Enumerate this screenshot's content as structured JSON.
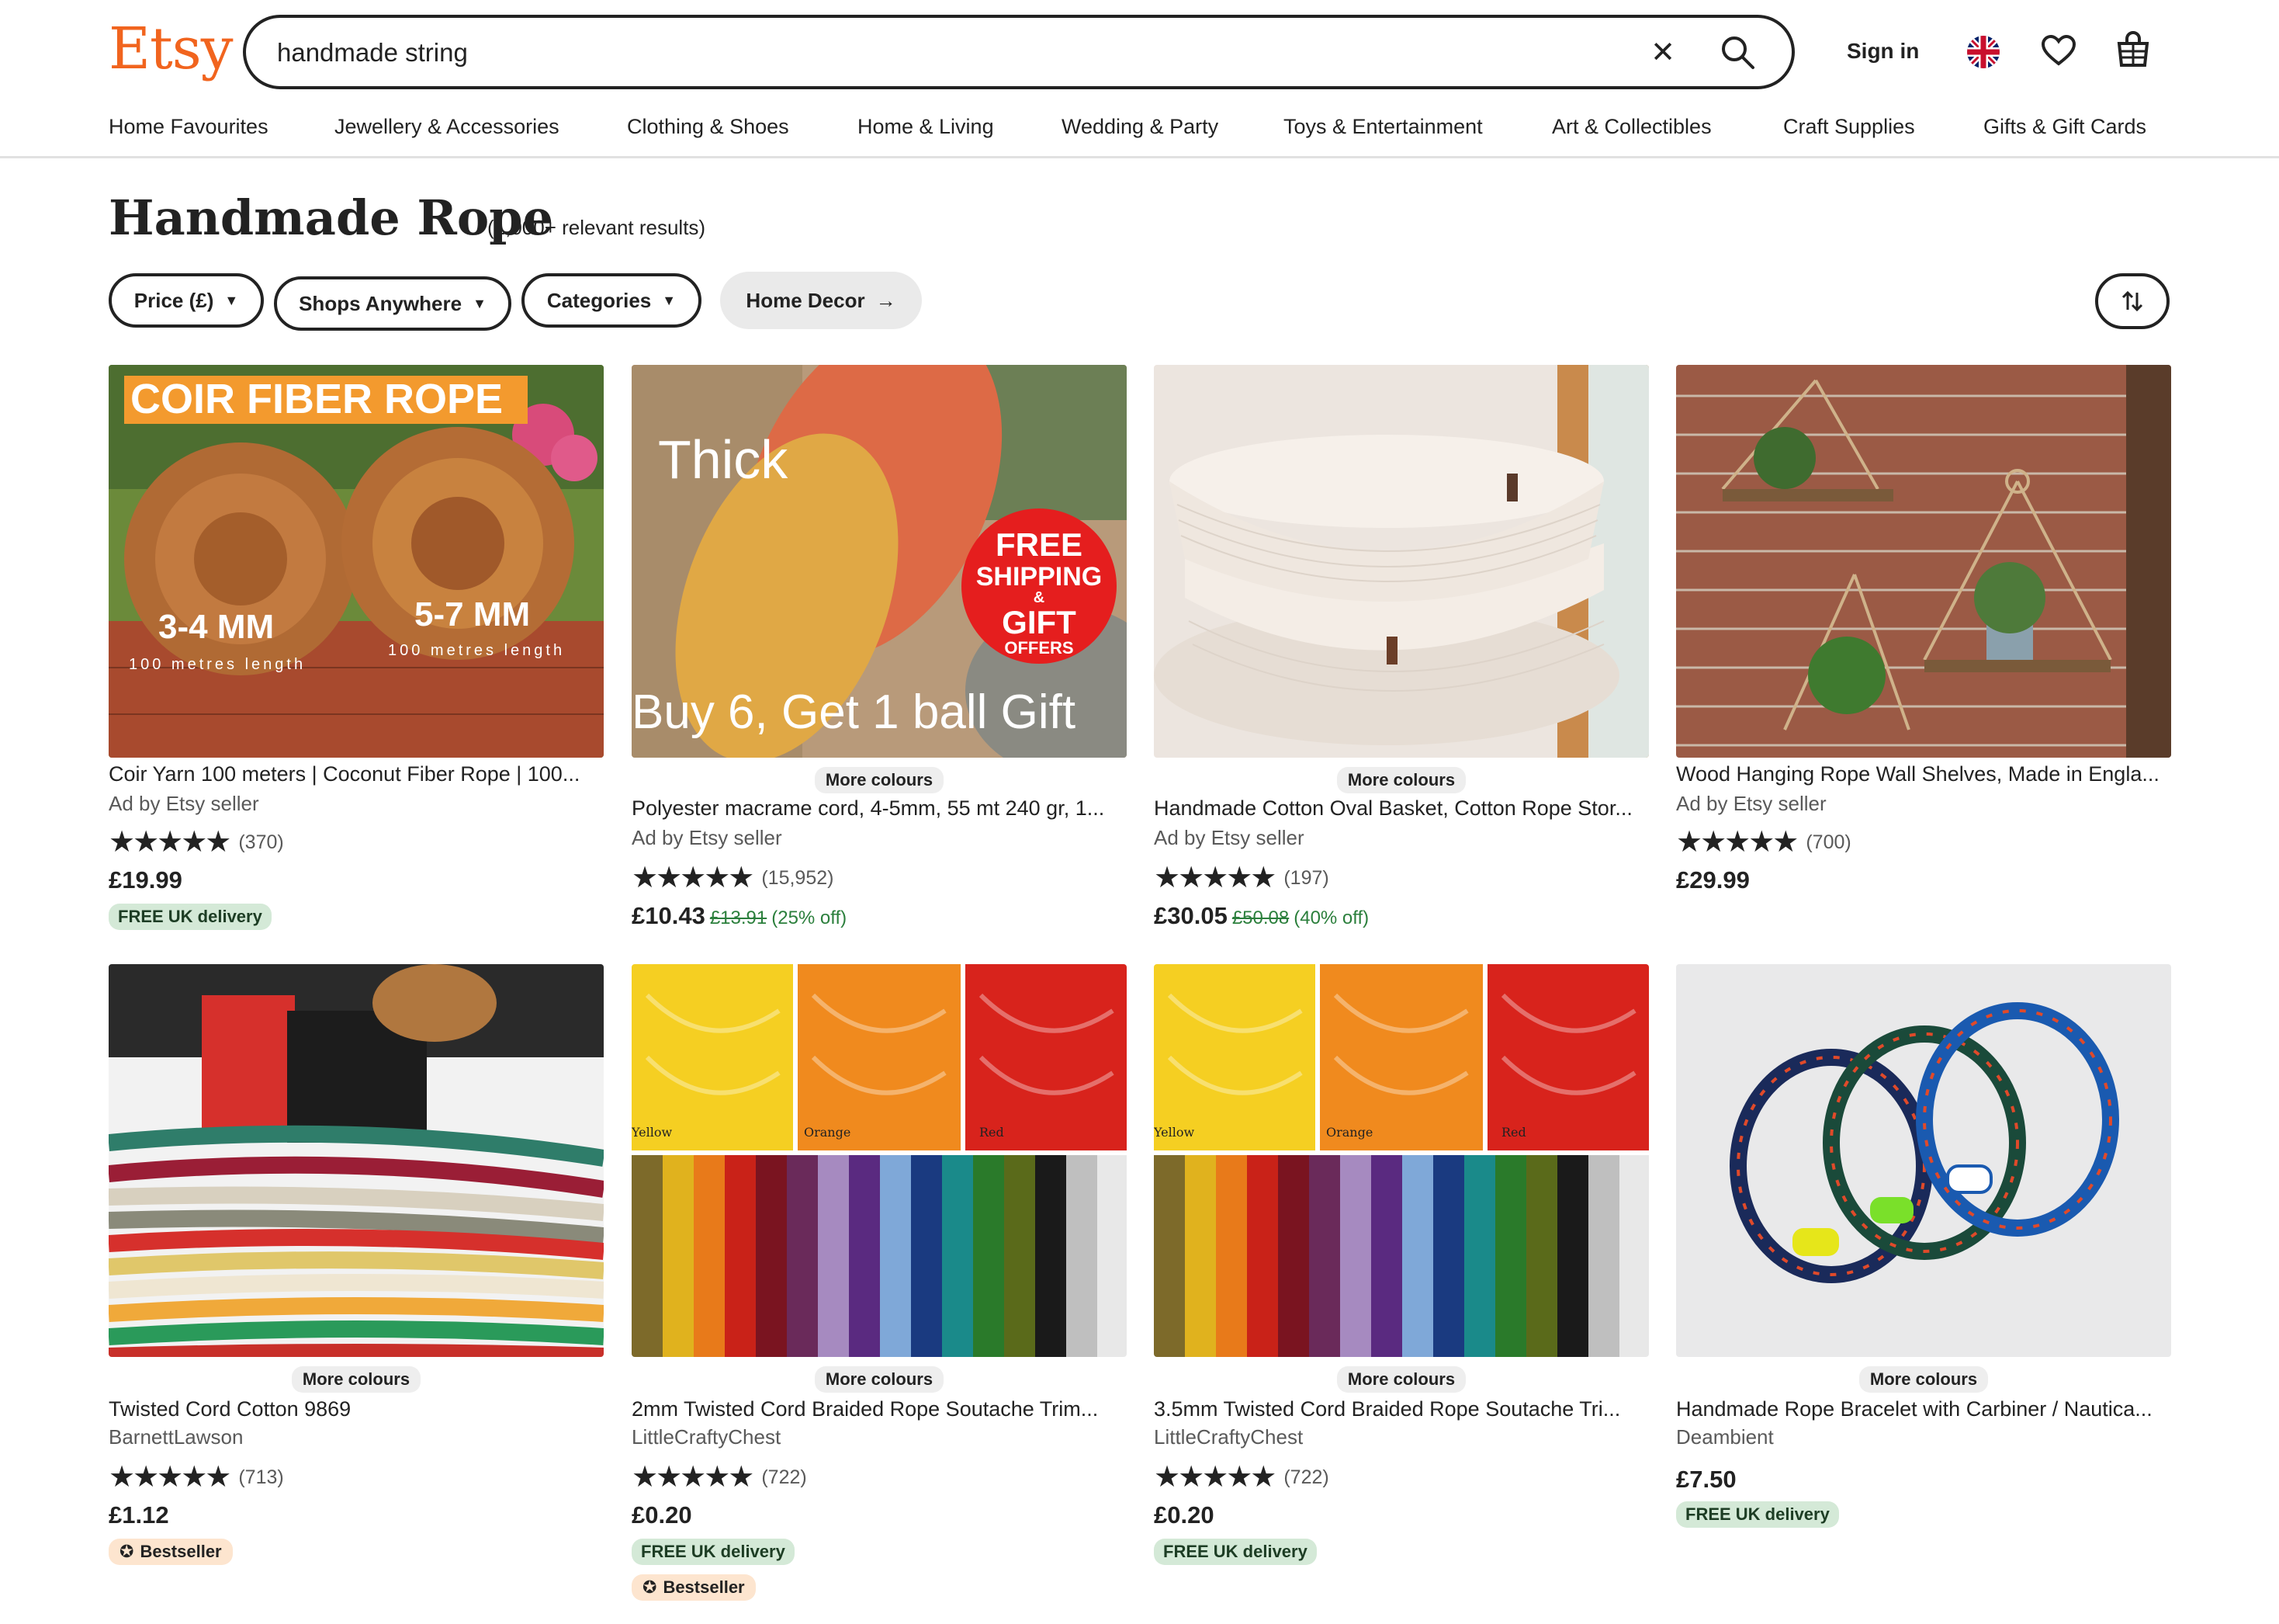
{
  "header": {
    "logo": "Etsy",
    "search_value": "handmade string",
    "sign_in": "Sign in"
  },
  "nav": [
    "Home Favourites",
    "Jewellery & Accessories",
    "Clothing & Shoes",
    "Home & Living",
    "Wedding & Party",
    "Toys & Entertainment",
    "Art & Collectibles",
    "Craft Supplies",
    "Gifts & Gift Cards"
  ],
  "results": {
    "title": "Handmade Rope",
    "count": "(1,000+ relevant results)"
  },
  "filters": {
    "price": "Price (£)",
    "shops": "Shops Anywhere",
    "categories": "Categories",
    "home_decor": "Home Decor"
  },
  "colors": {
    "brand": "#f1641e",
    "free_delivery_bg": "#d4e9d7",
    "bestseller_bg": "#fde5cf",
    "discount": "#2b7f3c"
  },
  "products": [
    {
      "title": "Coir Yarn 100 meters | Coconut Fiber Rope | 100...",
      "seller": "Ad by Etsy seller",
      "stars": "★★★★★",
      "reviews": "(370)",
      "price": "£19.99",
      "free_delivery": "FREE UK delivery",
      "image_text": {
        "banner": "COIR FIBER ROPE",
        "left": "3-4 MM",
        "left_sub": "100 metres length",
        "right": "5-7 MM",
        "right_sub": "100 metres length"
      }
    },
    {
      "more_colours": "More colours",
      "title": "Polyester macrame cord, 4-5mm, 55 mt 240 gr, 1...",
      "seller": "Ad by Etsy seller",
      "stars": "★★★★★",
      "reviews": "(15,952)",
      "price": "£10.43",
      "old_price": "£13.91",
      "discount": "(25% off)",
      "image_text": {
        "top": "Thick",
        "badge1": "FREE",
        "badge2": "SHIPPING",
        "badge3": "&",
        "badge4": "GIFT",
        "badge5": "OFFERS",
        "bottom": "Buy 6, Get 1 ball Gift"
      }
    },
    {
      "more_colours": "More colours",
      "title": "Handmade Cotton Oval Basket, Cotton Rope Stor...",
      "seller": "Ad by Etsy seller",
      "stars": "★★★★★",
      "reviews": "(197)",
      "price": "£30.05",
      "old_price": "£50.08",
      "discount": "(40% off)"
    },
    {
      "title": "Wood Hanging Rope Wall Shelves, Made in Engla...",
      "seller": "Ad by Etsy seller",
      "stars": "★★★★★",
      "reviews": "(700)",
      "price": "£29.99"
    },
    {
      "more_colours": "More colours",
      "title": "Twisted Cord Cotton 9869",
      "seller": "BarnettLawson",
      "stars": "★★★★★",
      "reviews": "(713)",
      "price": "£1.12",
      "bestseller": "Bestseller"
    },
    {
      "more_colours": "More colours",
      "title": "2mm Twisted Cord Braided Rope Soutache Trim...",
      "seller": "LittleCraftyChest",
      "stars": "★★★★★",
      "reviews": "(722)",
      "price": "£0.20",
      "free_delivery": "FREE UK delivery",
      "bestseller": "Bestseller",
      "image_text": {
        "l1": "Yellow",
        "l2": "Orange",
        "l3": "Red"
      }
    },
    {
      "more_colours": "More colours",
      "title": "3.5mm Twisted Cord Braided Rope Soutache Tri...",
      "seller": "LittleCraftyChest",
      "stars": "★★★★★",
      "reviews": "(722)",
      "price": "£0.20",
      "free_delivery": "FREE UK delivery",
      "image_text": {
        "l1": "Yellow",
        "l2": "Orange",
        "l3": "Red"
      }
    },
    {
      "more_colours": "More colours",
      "title": "Handmade Rope Bracelet with Carbiner / Nautica...",
      "seller": "Deambient",
      "price": "£7.50",
      "free_delivery": "FREE UK delivery"
    }
  ]
}
